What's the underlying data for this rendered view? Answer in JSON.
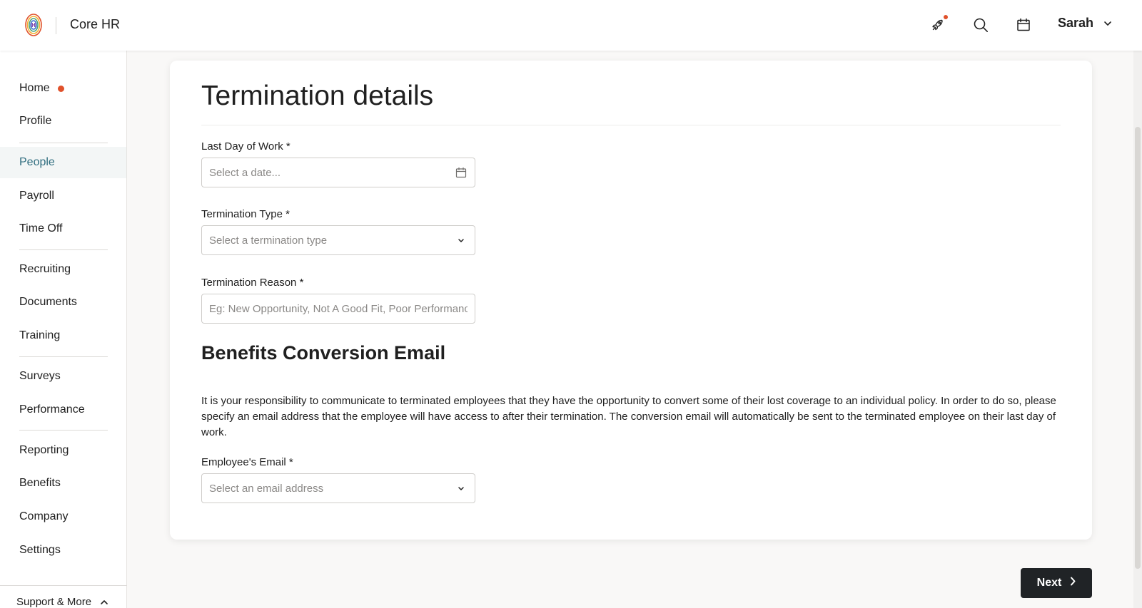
{
  "header": {
    "app_name": "Core HR",
    "user_name": "Sarah",
    "icons": [
      "rocket-icon",
      "search-icon",
      "calendar-icon",
      "chevron-down-icon"
    ]
  },
  "sidebar": {
    "items": [
      {
        "label": "Home",
        "badge": true
      },
      {
        "label": "Profile"
      },
      {
        "label": "People",
        "active": true
      },
      {
        "label": "Payroll"
      },
      {
        "label": "Time Off"
      },
      {
        "label": "Recruiting"
      },
      {
        "label": "Documents"
      },
      {
        "label": "Training"
      },
      {
        "label": "Surveys"
      },
      {
        "label": "Performance"
      },
      {
        "label": "Reporting"
      },
      {
        "label": "Benefits"
      },
      {
        "label": "Company"
      },
      {
        "label": "Settings"
      }
    ],
    "support_label": "Support & More"
  },
  "form": {
    "title": "Termination details",
    "last_day": {
      "label": "Last Day of Work *",
      "placeholder": "Select a date..."
    },
    "termination_type": {
      "label": "Termination Type *",
      "placeholder": "Select a termination type"
    },
    "termination_reason": {
      "label": "Termination Reason *",
      "placeholder": "Eg: New Opportunity, Not A Good Fit, Poor Performance"
    },
    "benefits_title": "Benefits Conversion Email",
    "benefits_text": "It is your responsibility to communicate to terminated employees that they have the opportunity to convert some of their lost coverage to an individual policy. In order to do so, please specify an email address that the employee will have access to after their termination. The conversion email will automatically be sent to the terminated employee on their last day of work.",
    "employee_email": {
      "label": "Employee's Email *",
      "placeholder": "Select an email address"
    }
  },
  "footer": {
    "next_label": "Next"
  },
  "colors": {
    "accent_dot": "#e0512b",
    "active_nav": "#2f6d7f",
    "button_dark": "#202326"
  }
}
